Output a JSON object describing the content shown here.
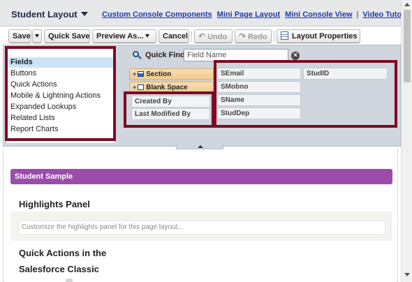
{
  "header": {
    "layout_title": "Student Layout",
    "links": [
      "Custom Console Components",
      "Mini Page Layout",
      "Mini Console View",
      "Video Tutorial"
    ],
    "separator": "|"
  },
  "toolbar": {
    "save": "Save",
    "quick_save": "Quick Save",
    "preview_as": "Preview As...",
    "cancel": "Cancel",
    "undo": "Undo",
    "redo": "Redo",
    "layout_properties": "Layout Properties",
    "undo_glyph": "↶",
    "redo_glyph": "↷"
  },
  "palette": {
    "categories": [
      "Fields",
      "Buttons",
      "Quick Actions",
      "Mobile & Lightning Actions",
      "Expanded Lookups",
      "Related Lists",
      "Report Charts"
    ],
    "selected_category": "Fields",
    "quick_find": {
      "label": "Quick Find",
      "placeholder": "Field Name",
      "clear_glyph": "×"
    },
    "structure_items": [
      "Section",
      "Blank Space"
    ],
    "standard_fields": [
      "Created By",
      "Last Modified By"
    ],
    "custom_fields": [
      "SEmail",
      "StudID",
      "SMobno",
      "SName",
      "StudDep"
    ]
  },
  "canvas": {
    "section_title": "Student Sample",
    "highlights_title": "Highlights Panel",
    "highlights_placeholder": "Customize the highlights panel for this page layout...",
    "quick_actions_title_line1": "Quick Actions in the",
    "quick_actions_title_line2": "Salesforce Classic"
  },
  "colors": {
    "highlight_border": "#7e0b22",
    "section_header": "#9b4cab",
    "palette_bg": "#cfd6de",
    "link": "#1c3aa9"
  },
  "icons": {
    "quick_find": "search-icon",
    "clear": "clear-icon",
    "layout_properties": "layout-properties-icon",
    "undo": "undo-icon",
    "redo": "redo-icon"
  }
}
